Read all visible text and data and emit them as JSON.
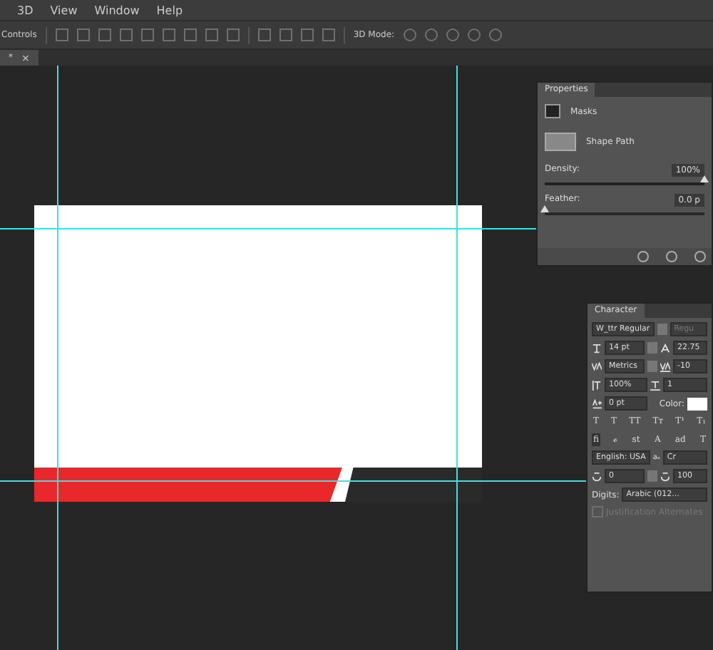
{
  "menu_bar": {
    "items": [
      "3D",
      "View",
      "Window",
      "Help"
    ]
  },
  "options_bar": {
    "label": "Controls",
    "mode_label": "3D Mode:"
  },
  "document_tab": {
    "label": "*",
    "close": "×"
  },
  "properties_panel": {
    "title": "Properties",
    "section": "Masks",
    "layer": "Shape Path",
    "sliders": [
      {
        "label": "Density:",
        "value": "100%",
        "level": 1.0
      },
      {
        "label": "Feather:",
        "value": "0.0 p",
        "level": 0.0
      }
    ]
  },
  "character_panel": {
    "title": "Character",
    "font_family": "W_ttr Regular",
    "font_style": {
      "value": "Regu",
      "disabled": true
    },
    "size": "14 pt",
    "leading": "22.75",
    "kerning": "Metrics",
    "tracking": "-10",
    "vertical_scale": "100%",
    "horizontal_scale": "1",
    "baseline_shift": "0 pt",
    "color_label": "Color:",
    "style_buttons": [
      "T",
      "T",
      "TT",
      "Tт",
      "T¹",
      "T₁"
    ],
    "opentype_buttons": [
      "fi",
      "ℴ",
      "st",
      "A",
      "ad",
      "T"
    ],
    "language": "English: USA",
    "antialias_icon": "aₐ",
    "antialias": "Cr",
    "field_1": "0",
    "field_2": "100",
    "digits_label": "Digits:",
    "digits": "Arabic (012...",
    "justification": {
      "label": "Justification Alternates",
      "checked": false,
      "disabled": true
    }
  }
}
